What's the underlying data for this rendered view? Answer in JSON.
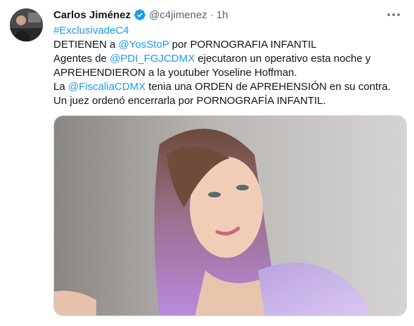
{
  "tweet": {
    "author_name": "Carlos Jiménez",
    "handle": "@c4jimenez",
    "separator": "·",
    "time": "1h",
    "hashtag": "#ExclusivadeC4",
    "line2_pre": "DETIENEN a ",
    "mention_yosstop": "@YosStoP",
    "line2_post": " por PORNOGRAFIA INFANTIL",
    "line3_pre": "Agentes de ",
    "mention_pdi": "@PDI_FGJCDMX",
    "line3_post": " ejecutaron un operativo esta noche y",
    "line4": "APREHENDIERON a la youtuber Yoseline Hoffman.",
    "line5_pre": "La ",
    "mention_fiscalia": "@FiscaliaCDMX",
    "line5_post": " tenia una ORDEN de APREHENSIÓN en su contra.",
    "line6": "Un juez ordenó encerrarla por PORNOGRAFÍA INFANTIL."
  },
  "icons": {
    "verified": "verified-badge-icon",
    "more": "more-options-icon"
  },
  "colors": {
    "link": "#1d9bf0",
    "secondary_text": "#536471",
    "verified_badge": "#1d9bf0"
  }
}
